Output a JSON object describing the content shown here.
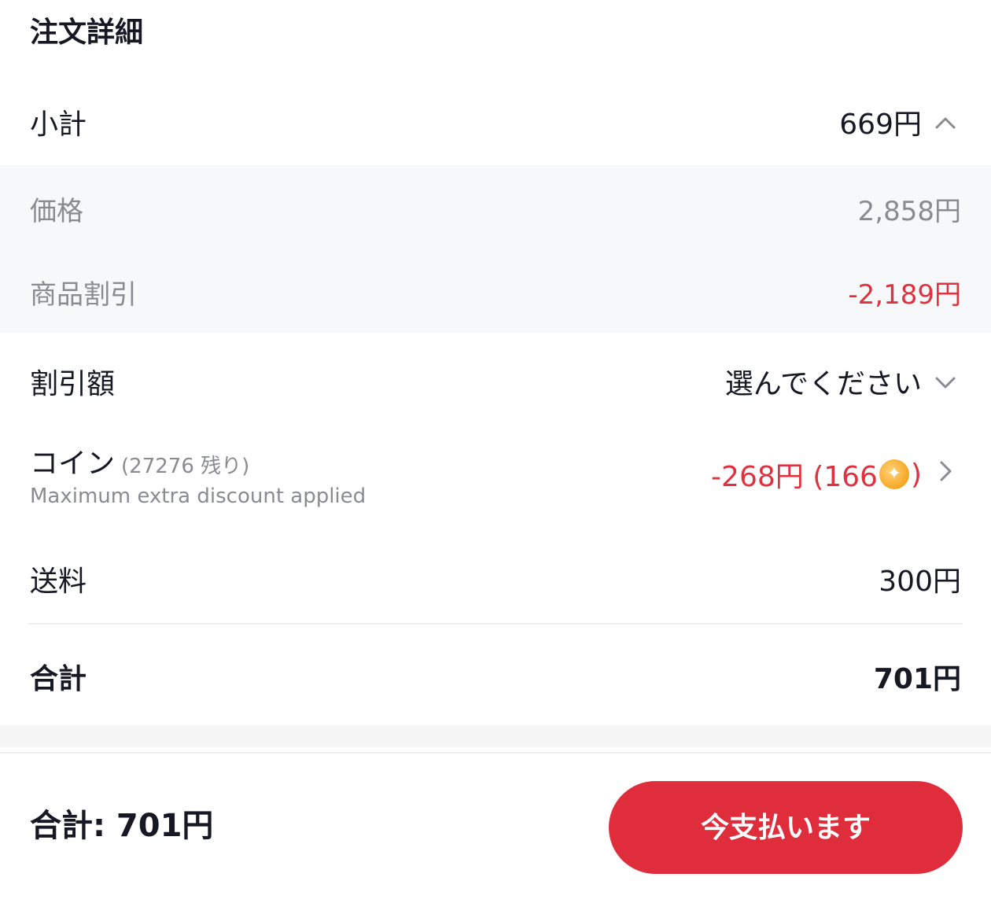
{
  "order_details": {
    "title": "注文詳細",
    "subtotal": {
      "label": "小計",
      "value": "669円",
      "expanded": true
    },
    "breakdown": {
      "price": {
        "label": "価格",
        "value": "2,858円"
      },
      "product_discount": {
        "label": "商品割引",
        "value": "-2,189円"
      }
    },
    "discount": {
      "label": "割引額",
      "value": "選んでください"
    },
    "coins": {
      "label": "コイン",
      "remaining": "(27276 残り)",
      "subtext": "Maximum extra discount applied",
      "value_prefix": "-268円 (166",
      "value_suffix": ")"
    },
    "shipping": {
      "label": "送料",
      "value": "300円"
    },
    "total": {
      "label": "合計",
      "value": "701円"
    }
  },
  "footer": {
    "total": "合計: 701円",
    "pay_button_label": "今支払います"
  },
  "colors": {
    "accent_red": "#e02d3c",
    "discount_red": "#e0313e",
    "muted_text": "#8a8b91",
    "breakdown_bg": "#f7f8fa"
  }
}
